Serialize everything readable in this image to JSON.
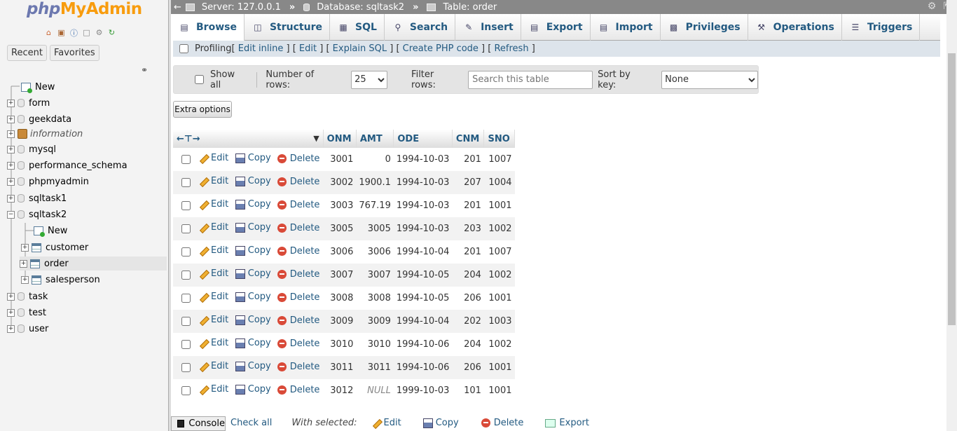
{
  "logo": {
    "php": "php",
    "myadmin": "MyAdmin"
  },
  "nav": {
    "recent": "Recent",
    "favorites": "Favorites",
    "tree": [
      {
        "label": "New",
        "kind": "new"
      },
      {
        "label": "form",
        "kind": "db"
      },
      {
        "label": "geekdata",
        "kind": "db"
      },
      {
        "label": "information",
        "kind": "info"
      },
      {
        "label": "mysql",
        "kind": "db"
      },
      {
        "label": "performance_schema",
        "kind": "db"
      },
      {
        "label": "phpmyadmin",
        "kind": "db"
      },
      {
        "label": "sqltask1",
        "kind": "db"
      },
      {
        "label": "sqltask2",
        "kind": "db-open"
      },
      {
        "label": "New",
        "kind": "new-sub"
      },
      {
        "label": "customer",
        "kind": "table"
      },
      {
        "label": "order",
        "kind": "table-selected"
      },
      {
        "label": "salesperson",
        "kind": "table"
      },
      {
        "label": "task",
        "kind": "db"
      },
      {
        "label": "test",
        "kind": "db"
      },
      {
        "label": "user",
        "kind": "db"
      }
    ]
  },
  "breadcrumb": {
    "server": "Server: 127.0.0.1",
    "database": "Database: sqltask2",
    "table": "Table: order"
  },
  "tabs": [
    "Browse",
    "Structure",
    "SQL",
    "Search",
    "Insert",
    "Export",
    "Import",
    "Privileges",
    "Operations",
    "Triggers"
  ],
  "profiling": {
    "label": "Profiling",
    "links": [
      "Edit inline",
      "Edit",
      "Explain SQL",
      "Create PHP code",
      "Refresh"
    ]
  },
  "filter": {
    "show_all": "Show all",
    "number_of_rows_label": "Number of rows:",
    "number_of_rows_value": "25",
    "filter_rows_label": "Filter rows:",
    "filter_placeholder": "Search this table",
    "sort_by_key_label": "Sort by key:",
    "sort_by_key_value": "None"
  },
  "extra_options": "Extra options",
  "table": {
    "columns": [
      "ONM",
      "AMT",
      "ODE",
      "CNM",
      "SNO"
    ],
    "actions": {
      "edit": "Edit",
      "copy": "Copy",
      "delete": "Delete"
    },
    "rows": [
      [
        "3001",
        "0",
        "1994-10-03",
        "201",
        "1007"
      ],
      [
        "3002",
        "1900.1",
        "1994-10-03",
        "207",
        "1004"
      ],
      [
        "3003",
        "767.19",
        "1994-10-03",
        "201",
        "1001"
      ],
      [
        "3005",
        "3005",
        "1994-10-03",
        "203",
        "1002"
      ],
      [
        "3006",
        "3006",
        "1994-10-04",
        "201",
        "1007"
      ],
      [
        "3007",
        "3007",
        "1994-10-05",
        "204",
        "1002"
      ],
      [
        "3008",
        "3008",
        "1994-10-05",
        "206",
        "1001"
      ],
      [
        "3009",
        "3009",
        "1994-10-04",
        "202",
        "1003"
      ],
      [
        "3010",
        "3010",
        "1994-10-06",
        "204",
        "1002"
      ],
      [
        "3011",
        "3011",
        "1994-10-06",
        "206",
        "1001"
      ],
      [
        "3012",
        "NULL",
        "1999-10-03",
        "101",
        "1001"
      ]
    ]
  },
  "bottom": {
    "console": "Console",
    "check_all": "Check all",
    "with_selected": "With selected:",
    "edit": "Edit",
    "copy": "Copy",
    "delete": "Delete",
    "export": "Export"
  }
}
